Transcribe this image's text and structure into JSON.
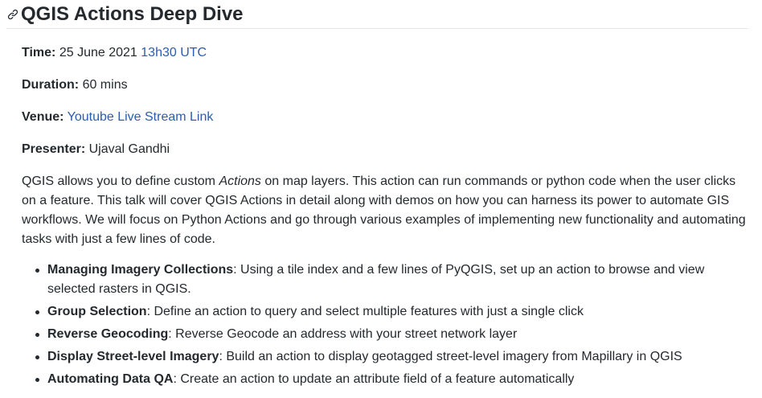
{
  "title": "QGIS Actions Deep Dive",
  "details": {
    "time_label": "Time:",
    "time_date": "25 June 2021",
    "time_link": "13h30 UTC",
    "duration_label": "Duration:",
    "duration_value": "60 mins",
    "venue_label": "Venue:",
    "venue_link": "Youtube Live Stream Link",
    "presenter_label": "Presenter:",
    "presenter_value": "Ujaval Gandhi"
  },
  "description": {
    "part1": "QGIS allows you to define custom ",
    "emphasis": "Actions",
    "part2": " on map layers. This action can run commands or python code when the user clicks on a feature. This talk will cover QGIS Actions in detail along with demos on how you can harness its power to automate GIS workflows. We will focus on Python Actions and go through various examples of implementing new functionality and automating tasks with just a few lines of code."
  },
  "topics": [
    {
      "name": "Managing Imagery Collections",
      "text": ": Using a tile index and a few lines of PyQGIS, set up an action to browse and view selected rasters in QGIS."
    },
    {
      "name": "Group Selection",
      "text": ": Define an action to query and select multiple features with just a single click"
    },
    {
      "name": "Reverse Geocoding",
      "text": ": Reverse Geocode an address with your street network layer"
    },
    {
      "name": "Display Street-level Imagery",
      "text": ": Build an action to display geotagged street-level imagery from Mapillary in QGIS"
    },
    {
      "name": "Automating Data QA",
      "text": ": Create an action to update an attribute field of a feature automatically"
    }
  ]
}
